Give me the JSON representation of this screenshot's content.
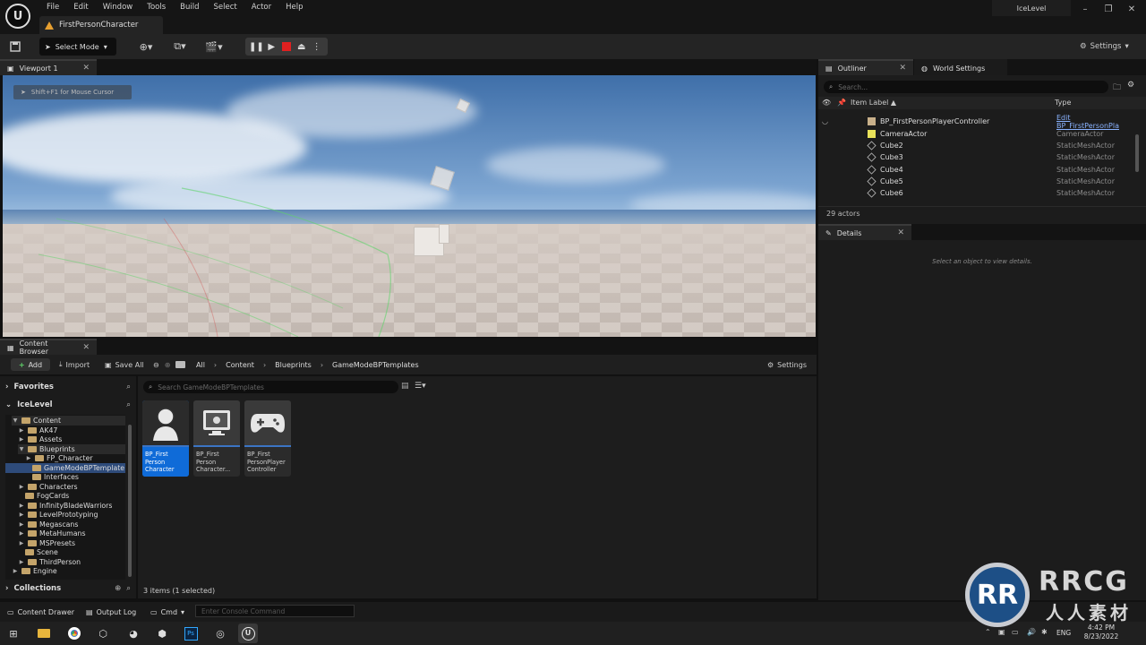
{
  "app": {
    "menus": [
      "File",
      "Edit",
      "Window",
      "Tools",
      "Build",
      "Select",
      "Actor",
      "Help"
    ],
    "document_tab": "FirstPersonCharacter",
    "level_tab": "IceLevel"
  },
  "toolbar": {
    "select_mode": "Select Mode",
    "settings": "Settings"
  },
  "viewport": {
    "tab": "Viewport 1",
    "hint": "Shift+F1 for Mouse Cursor"
  },
  "outliner": {
    "tab": "Outliner",
    "world_tab": "World Settings",
    "search_placeholder": "Search...",
    "col_label": "Item Label ▲",
    "col_type": "Type",
    "rows": [
      {
        "label": "BP_FirstPersonPlayerController",
        "type": "Edit BP_FirstPersonPla",
        "link": true
      },
      {
        "label": "CameraActor",
        "type": "CameraActor"
      },
      {
        "label": "Cube2",
        "type": "StaticMeshActor"
      },
      {
        "label": "Cube3",
        "type": "StaticMeshActor"
      },
      {
        "label": "Cube4",
        "type": "StaticMeshActor"
      },
      {
        "label": "Cube5",
        "type": "StaticMeshActor"
      },
      {
        "label": "Cube6",
        "type": "StaticMeshActor"
      }
    ],
    "actor_count": "29 actors"
  },
  "details": {
    "tab": "Details",
    "empty": "Select an object to view details."
  },
  "content_browser": {
    "tab": "Content Browser",
    "add": "Add",
    "import": "Import",
    "save_all": "Save All",
    "breadcrumbs": [
      "All",
      "Content",
      "Blueprints",
      "GameModeBPTemplates"
    ],
    "settings": "Settings",
    "favorites": "Favorites",
    "level": "IceLevel",
    "tree": [
      {
        "label": "Content",
        "depth": 1,
        "open": true
      },
      {
        "label": "AK47",
        "depth": 2
      },
      {
        "label": "Assets",
        "depth": 2
      },
      {
        "label": "Blueprints",
        "depth": 2,
        "open": true
      },
      {
        "label": "FP_Character",
        "depth": 3
      },
      {
        "label": "GameModeBPTemplate",
        "depth": 3,
        "selected": true
      },
      {
        "label": "Interfaces",
        "depth": 3
      },
      {
        "label": "Characters",
        "depth": 2
      },
      {
        "label": "FogCards",
        "depth": 2
      },
      {
        "label": "InfinityBladeWarriors",
        "depth": 2
      },
      {
        "label": "LevelPrototyping",
        "depth": 2
      },
      {
        "label": "Megascans",
        "depth": 2
      },
      {
        "label": "MetaHumans",
        "depth": 2
      },
      {
        "label": "MSPresets",
        "depth": 2
      },
      {
        "label": "Scene",
        "depth": 2
      },
      {
        "label": "ThirdPerson",
        "depth": 2
      },
      {
        "label": "Engine",
        "depth": 1
      }
    ],
    "collections": "Collections",
    "search_placeholder": "Search GameModeBPTemplates",
    "assets": [
      {
        "name": "BP_First Person Character",
        "selected": true
      },
      {
        "name": "BP_First Person Character..."
      },
      {
        "name": "BP_First PersonPlayer Controller"
      }
    ],
    "item_count": "3 items (1 selected)"
  },
  "statusbar": {
    "content_drawer": "Content Drawer",
    "output_log": "Output Log",
    "cmd": "Cmd",
    "console_placeholder": "Enter Console Command"
  },
  "taskbar": {
    "lang": "ENG",
    "time": "4:42 PM",
    "date": "8/23/2022"
  },
  "watermark": {
    "text": "RRCG",
    "sub": "人人素材"
  }
}
